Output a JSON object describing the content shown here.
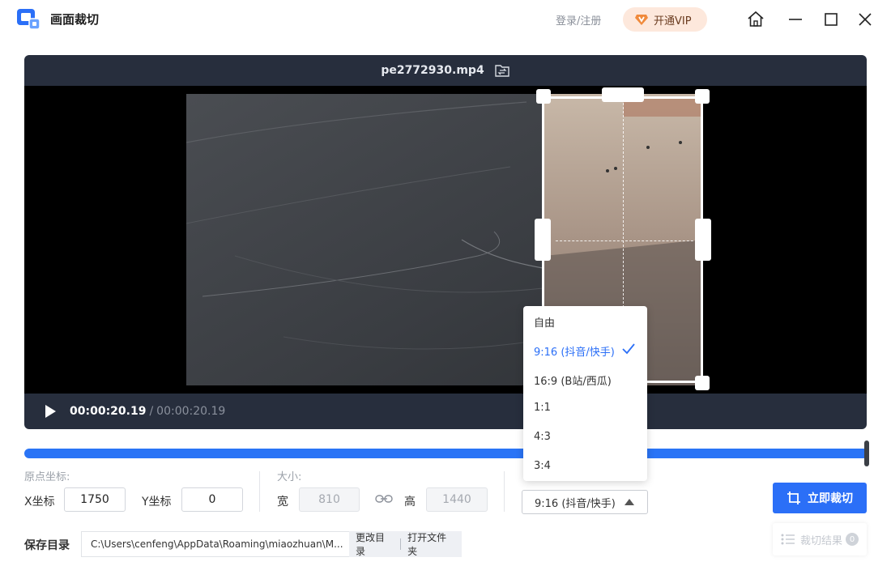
{
  "window": {
    "title": "画面裁切",
    "login_label": "登录/注册",
    "vip_label": "开通VIP"
  },
  "player": {
    "file_name": "pe2772930.mp4",
    "time_current": "00:00:20.19",
    "time_separator": "/",
    "time_total": "00:00:20.19"
  },
  "settings": {
    "origin_label": "原点坐标:",
    "x_label": "X坐标",
    "x_value": "1750",
    "y_label": "Y坐标",
    "y_value": "0",
    "size_label": "大小:",
    "width_label": "宽",
    "width_value": "810",
    "height_label": "高",
    "height_value": "1440",
    "ratio_selected": "9:16 (抖音/快手)"
  },
  "ratio_options": [
    {
      "label": "自由"
    },
    {
      "label": "9:16 (抖音/快手)"
    },
    {
      "label": "16:9 (B站/西瓜)"
    },
    {
      "label": "1:1"
    },
    {
      "label": "4:3"
    },
    {
      "label": "3:4"
    }
  ],
  "actions": {
    "crop_now": "立即裁切",
    "crop_results": "裁切结果",
    "crop_results_count": "0"
  },
  "save": {
    "label": "保存目录",
    "path": "C:\\Users\\cenfeng\\AppData\\Roaming\\miaozhuan\\M...",
    "change_dir": "更改目录",
    "open_folder": "打开文件夹"
  },
  "colors": {
    "accent": "#2b6ff7",
    "player_bg": "#272e3d",
    "vip_bg": "#fde8dc"
  }
}
